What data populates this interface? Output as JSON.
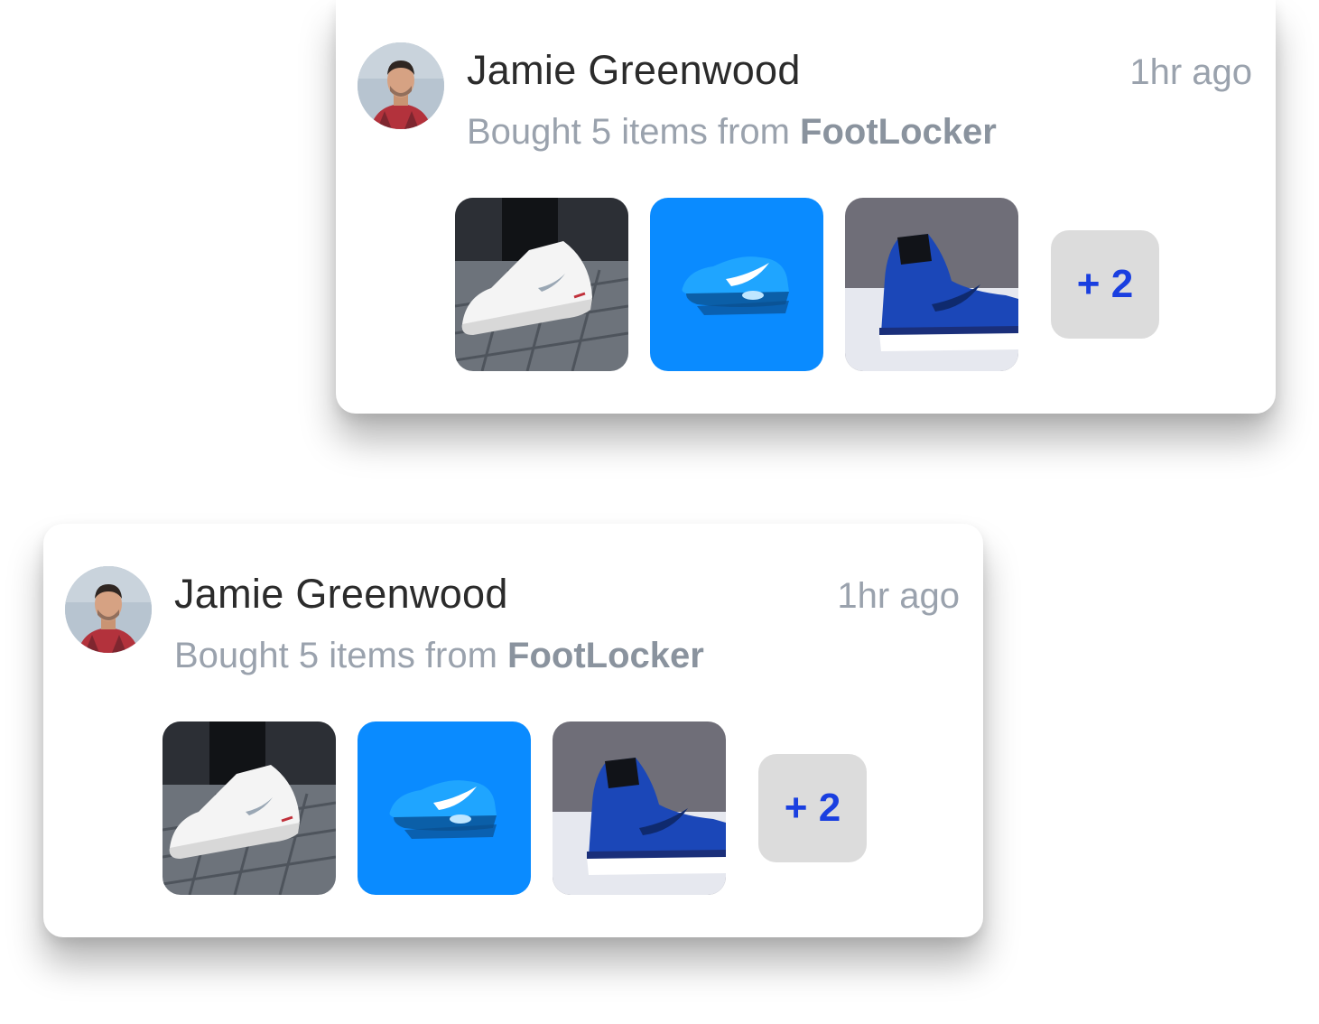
{
  "cards": [
    {
      "user_name": "Jamie Greenwood",
      "time_ago": "1hr ago",
      "action_prefix": "Bought 5 items from ",
      "store_name": "FootLocker",
      "more_count": "+ 2",
      "thumbnails": [
        "white-sneaker-photo",
        "blue-sneaker-photo",
        "blue-high-top-photo"
      ]
    },
    {
      "user_name": "Jamie Greenwood",
      "time_ago": "1hr ago",
      "action_prefix": "Bought 5 items from ",
      "store_name": "FootLocker",
      "more_count": "+ 2",
      "thumbnails": [
        "white-sneaker-photo",
        "blue-sneaker-photo",
        "blue-high-top-photo"
      ]
    }
  ],
  "colors": {
    "card_bg": "#ffffff",
    "name_text": "#2b2b2b",
    "muted_text": "#9aa2ad",
    "more_badge_bg": "#dcdcdc",
    "more_badge_text": "#1a3fe0",
    "blue_thumb_bg": "#0a8bff"
  }
}
